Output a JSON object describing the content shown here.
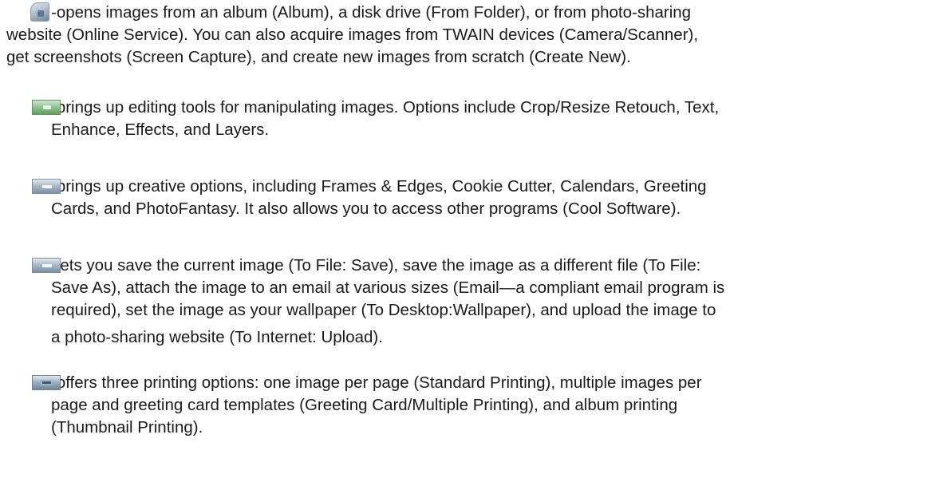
{
  "paragraphs": [
    {
      "icon": "album-icon",
      "lines": [
        "-opens images from an album (Album), a disk drive (From Folder), or from photo-sharing",
        "website (Online Service). You can also acquire images from TWAIN devices (Camera/Scanner),",
        "get screenshots (Screen Capture), and create new images from scratch (Create New)."
      ]
    },
    {
      "icon": "edit-icon",
      "lines": [
        "-brings up editing tools for manipulating images. Options include Crop/Resize Retouch, Text,",
        "Enhance, Effects, and Layers."
      ]
    },
    {
      "icon": "create-icon",
      "lines": [
        "-brings up creative options, including Frames & Edges, Cookie Cutter, Calendars, Greeting",
        "Cards, and PhotoFantasy. It also allows you to access other programs (Cool Software)."
      ]
    },
    {
      "icon": "share-icon",
      "lines": [
        "-lets you save the current image (To File: Save), save the image as a different file (To File:",
        "Save As), attach the image to an email at various sizes (Email—a compliant email program is",
        "required), set the image as your wallpaper (To Desktop:Wallpaper), and upload the image to",
        "a photo-sharing website (To Internet: Upload)."
      ]
    },
    {
      "icon": "print-icon",
      "lines": [
        "-offers three printing options: one image per page (Standard Printing), multiple images per",
        "page and greeting card templates (Greeting Card/Multiple Printing), and album printing",
        "(Thumbnail Printing)."
      ]
    }
  ]
}
